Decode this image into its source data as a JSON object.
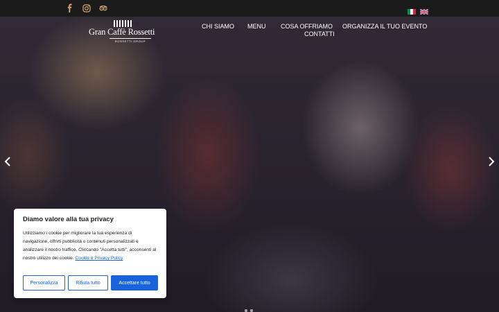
{
  "social": [
    {
      "icon": "facebook-icon",
      "color": "#c9a36b"
    },
    {
      "icon": "instagram-icon",
      "color": "#c9a36b"
    },
    {
      "icon": "tripadvisor-icon",
      "color": "#c9a36b"
    }
  ],
  "languages": [
    {
      "code": "it",
      "icon": "italian-flag-icon"
    },
    {
      "code": "en",
      "icon": "english-flag-icon"
    }
  ],
  "logo": {
    "name": "Gran Caffè Rossetti",
    "sub": "ROSSETTI GROUP"
  },
  "nav": {
    "chi_siamo": "CHI SIAMO",
    "menu": "MENU",
    "cosa_offriamo": "COSA OFFRIAMO",
    "organizza": "ORGANIZZA IL TUO EVENTO",
    "contatti": "CONTATTI"
  },
  "cookie": {
    "title": "Diamo valore alla tua privacy",
    "text": "Utilizziamo i cookie per migliorare la tua esperienza di navigazione, offrirti pubblicità o contenuti personalizzati e analizzare il nostro traffico. Cliccando \"Accetta tutti\", acconsenti al nostro utilizzo dei cookie.",
    "link": "Cookie e Privacy Policy",
    "customize": "Personalizza",
    "reject": "Rifiuta tutto",
    "accept": "Accettare tutto",
    "accent": "#1863dc"
  }
}
